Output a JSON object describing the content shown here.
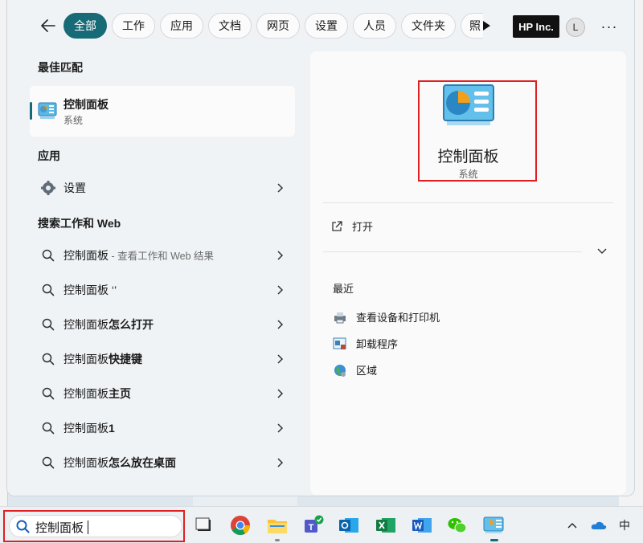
{
  "filters": {
    "items": [
      {
        "label": "全部",
        "active": true
      },
      {
        "label": "工作",
        "active": false
      },
      {
        "label": "应用",
        "active": false
      },
      {
        "label": "文档",
        "active": false
      },
      {
        "label": "网页",
        "active": false
      },
      {
        "label": "设置",
        "active": false
      },
      {
        "label": "人员",
        "active": false
      },
      {
        "label": "文件夹",
        "active": false
      },
      {
        "label": "照",
        "active": false
      }
    ],
    "org_badge": "HP Inc.",
    "avatar_initial": "L",
    "more": "···"
  },
  "left": {
    "best_match_title": "最佳匹配",
    "best_match": {
      "name": "控制面板",
      "type": "系统"
    },
    "apps_title": "应用",
    "apps": [
      {
        "label": "设置"
      }
    ],
    "web_title": "搜索工作和 Web",
    "web_results": [
      {
        "prefix": "控制面板",
        "suffix": "",
        "note": " - 查看工作和 Web 结果"
      },
      {
        "prefix": "控制面板 ‘’",
        "suffix": "",
        "note": ""
      },
      {
        "prefix": "控制面板",
        "suffix": "怎么打开",
        "note": ""
      },
      {
        "prefix": "控制面板",
        "suffix": "快捷键",
        "note": ""
      },
      {
        "prefix": "控制面板",
        "suffix": "主页",
        "note": ""
      },
      {
        "prefix": "控制面板",
        "suffix": "1",
        "note": ""
      },
      {
        "prefix": "控制面板",
        "suffix": "怎么放在桌面",
        "note": ""
      }
    ]
  },
  "right": {
    "title": "控制面板",
    "subtitle": "系统",
    "open_label": "打开",
    "recent_title": "最近",
    "recent": [
      {
        "label": "查看设备和打印机",
        "icon": "printer-icon"
      },
      {
        "label": "卸载程序",
        "icon": "uninstall-icon"
      },
      {
        "label": "区域",
        "icon": "globe-icon"
      }
    ]
  },
  "taskbar": {
    "search_value": "控制面板",
    "apps": [
      "task-view",
      "chrome",
      "file-explorer",
      "teams",
      "outlook",
      "excel",
      "word",
      "wechat",
      "control-panel"
    ],
    "ime": "中"
  },
  "colors": {
    "accent": "#176b76",
    "highlight": "#e02020"
  }
}
